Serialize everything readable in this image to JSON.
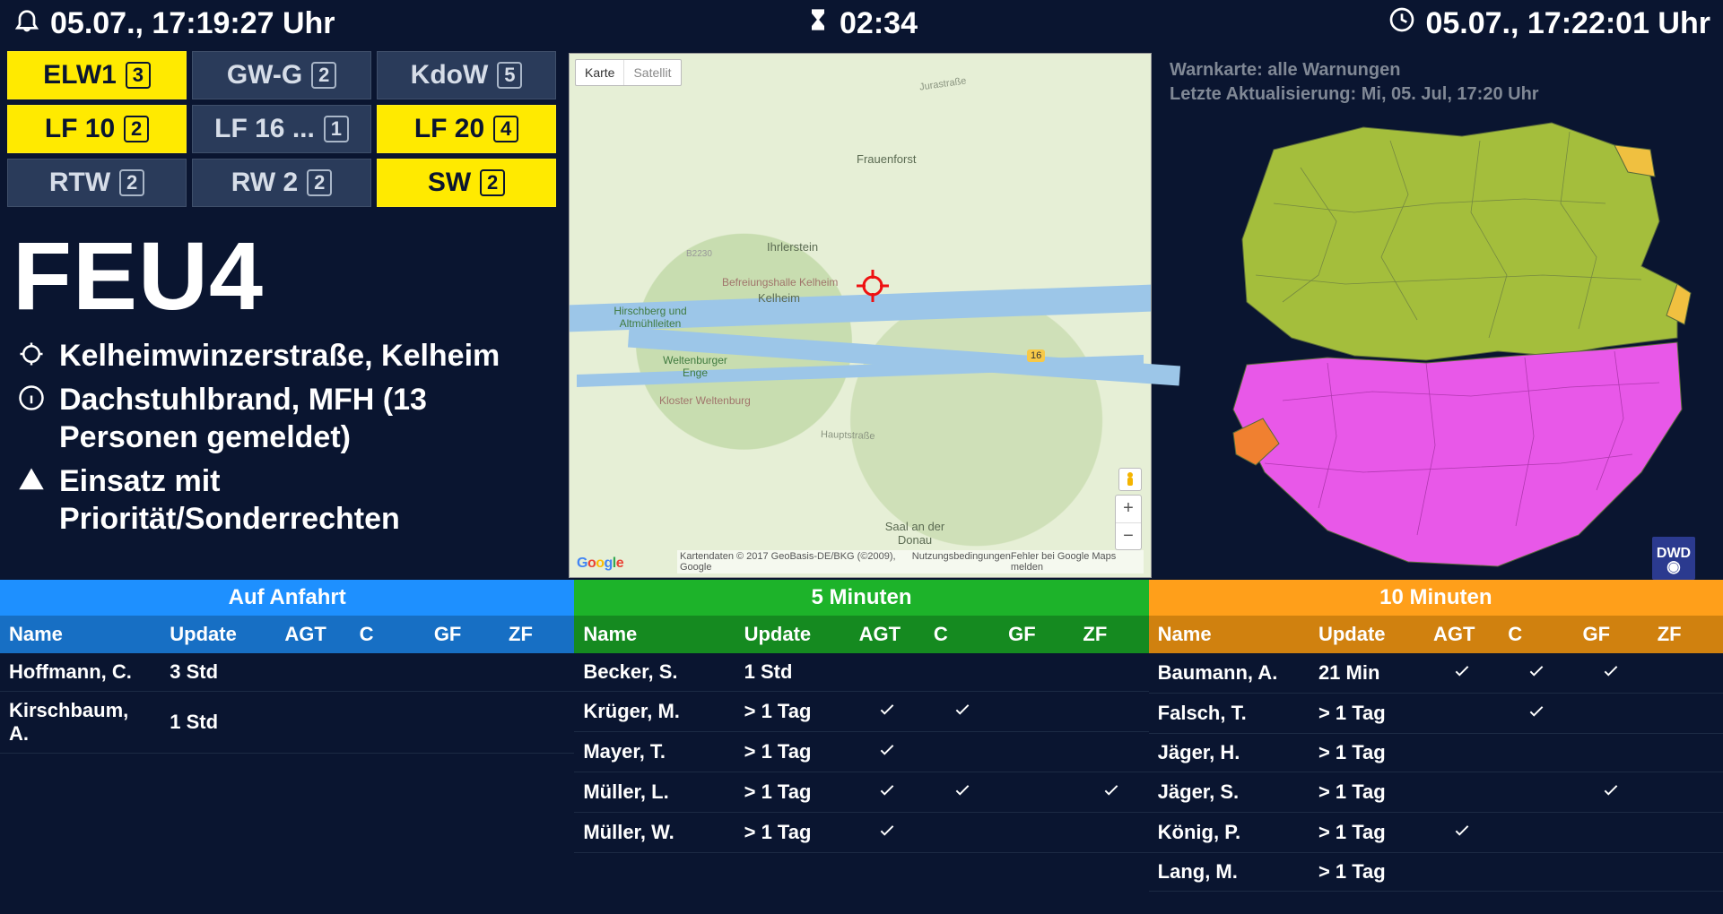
{
  "header": {
    "alarm_time": "05.07., 17:19:27 Uhr",
    "elapsed": "02:34",
    "clock_time": "05.07., 17:22:01 Uhr"
  },
  "vehicles": [
    {
      "name": "ELW1",
      "count": "3",
      "style": "yellow"
    },
    {
      "name": "GW-G",
      "count": "2",
      "style": "gray"
    },
    {
      "name": "KdoW",
      "count": "5",
      "style": "gray"
    },
    {
      "name": "LF 10",
      "count": "2",
      "style": "yellow"
    },
    {
      "name": "LF 16 ...",
      "count": "1",
      "style": "gray"
    },
    {
      "name": "LF 20",
      "count": "4",
      "style": "yellow"
    },
    {
      "name": "RTW",
      "count": "2",
      "style": "gray"
    },
    {
      "name": "RW 2",
      "count": "2",
      "style": "gray"
    },
    {
      "name": "SW",
      "count": "2",
      "style": "yellow"
    }
  ],
  "incident": {
    "keyword": "FEU4",
    "address": "Kelheimwinzerstraße, Kelheim",
    "description": "Dachstuhlbrand, MFH (13 Personen gemeldet)",
    "priority": "Einsatz mit Priorität/Sonderrechten"
  },
  "map": {
    "tab_map": "Karte",
    "tab_satellite": "Satellit",
    "labels": {
      "frauenforst": "Frauenforst",
      "jurastrasse": "Jurastraße",
      "ihrlerstein": "Ihrlerstein",
      "befreiungshalle": "Befreiungshalle Kelheim",
      "kelheim": "Kelheim",
      "hirschberg": "Hirschberg und Altmühlleiten",
      "weltenburg_enge": "Weltenburger Enge",
      "kloster": "Kloster Weltenburg",
      "hauptstrasse": "Hauptstraße",
      "saal": "Saal an der Donau",
      "b2230": "B2230",
      "route16": "16"
    },
    "zoom_in": "+",
    "zoom_out": "−",
    "attribution": "Kartendaten © 2017 GeoBasis-DE/BKG (©2009), Google",
    "terms": "Nutzungsbedingungen",
    "report": "Fehler bei Google Maps melden"
  },
  "warning": {
    "title": "Warnkarte: alle Warnungen",
    "updated": "Letzte Aktualisierung: Mi, 05. Jul, 17:20 Uhr",
    "badge": "DWD"
  },
  "tables": {
    "headers": {
      "name": "Name",
      "update": "Update",
      "agt": "AGT",
      "c": "C",
      "gf": "GF",
      "zf": "ZF"
    },
    "enroute": {
      "title": "Auf Anfahrt",
      "rows": [
        {
          "name": "Hoffmann, C.",
          "update": "3 Std",
          "agt": false,
          "c": false,
          "gf": false,
          "zf": false
        },
        {
          "name": "Kirschbaum, A.",
          "update": "1 Std",
          "agt": false,
          "c": false,
          "gf": false,
          "zf": false
        }
      ]
    },
    "five": {
      "title": "5 Minuten",
      "rows": [
        {
          "name": "Becker, S.",
          "update": "1 Std",
          "agt": false,
          "c": false,
          "gf": false,
          "zf": false
        },
        {
          "name": "Krüger, M.",
          "update": "> 1 Tag",
          "agt": true,
          "c": true,
          "gf": false,
          "zf": false
        },
        {
          "name": "Mayer, T.",
          "update": "> 1 Tag",
          "agt": true,
          "c": false,
          "gf": false,
          "zf": false
        },
        {
          "name": "Müller, L.",
          "update": "> 1 Tag",
          "agt": true,
          "c": true,
          "gf": false,
          "zf": true
        },
        {
          "name": "Müller, W.",
          "update": "> 1 Tag",
          "agt": true,
          "c": false,
          "gf": false,
          "zf": false
        }
      ]
    },
    "ten": {
      "title": "10 Minuten",
      "rows": [
        {
          "name": "Baumann, A.",
          "update": "21 Min",
          "agt": true,
          "c": true,
          "gf": true,
          "zf": false
        },
        {
          "name": "Falsch, T.",
          "update": "> 1 Tag",
          "agt": false,
          "c": true,
          "gf": false,
          "zf": false
        },
        {
          "name": "Jäger, H.",
          "update": "> 1 Tag",
          "agt": false,
          "c": false,
          "gf": false,
          "zf": false
        },
        {
          "name": "Jäger, S.",
          "update": "> 1 Tag",
          "agt": false,
          "c": false,
          "gf": true,
          "zf": false
        },
        {
          "name": "König, P.",
          "update": "> 1 Tag",
          "agt": true,
          "c": false,
          "gf": false,
          "zf": false
        },
        {
          "name": "Lang, M.",
          "update": "> 1 Tag",
          "agt": false,
          "c": false,
          "gf": false,
          "zf": false
        }
      ]
    }
  }
}
